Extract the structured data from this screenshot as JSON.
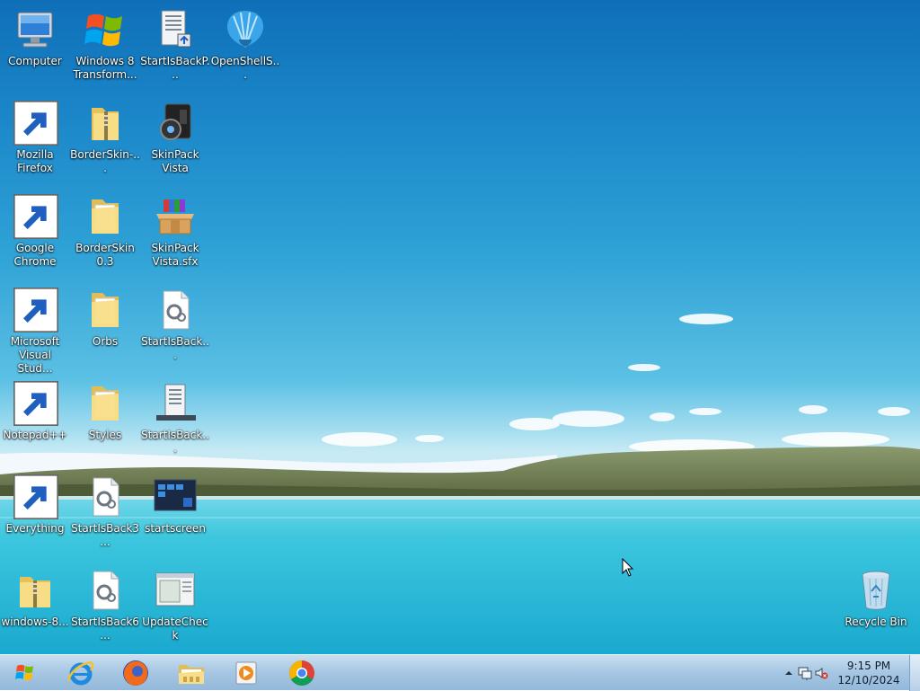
{
  "desktop": {
    "icons": [
      {
        "label": "Computer",
        "icon": "computer-icon"
      },
      {
        "label": "Windows 8 Transform...",
        "icon": "windows-logo-icon"
      },
      {
        "label": "StartIsBackP...",
        "icon": "installer-icon"
      },
      {
        "label": "OpenShellS...",
        "icon": "shell-icon"
      },
      {
        "label": "Mozilla Firefox",
        "icon": "firefox-icon"
      },
      {
        "label": "BorderSkin-...",
        "icon": "zip-folder-icon"
      },
      {
        "label": "SkinPack Vista",
        "icon": "skinpack-icon"
      },
      {
        "label": "Google Chrome",
        "icon": "chrome-icon"
      },
      {
        "label": "BorderSkin 0.3",
        "icon": "folder-icon"
      },
      {
        "label": "SkinPack Vista.sfx",
        "icon": "archive-box-icon"
      },
      {
        "label": "Microsoft Visual Stud...",
        "icon": "visual-studio-icon"
      },
      {
        "label": "Orbs",
        "icon": "folder-icon"
      },
      {
        "label": "StartIsBack...",
        "icon": "settings-file-icon"
      },
      {
        "label": "Notepad++",
        "icon": "notepad-plus-icon"
      },
      {
        "label": "Styles",
        "icon": "folder-icon"
      },
      {
        "label": "StartIsBack...",
        "icon": "installer-icon"
      },
      {
        "label": "Everything",
        "icon": "everything-search-icon"
      },
      {
        "label": "StartIsBack3...",
        "icon": "settings-file-icon"
      },
      {
        "label": "startscreen",
        "icon": "screenshot-file-icon"
      },
      {
        "label": "windows-8...",
        "icon": "zip-folder-icon"
      },
      {
        "label": "StartIsBack6...",
        "icon": "settings-file-icon"
      },
      {
        "label": "UpdateCheck",
        "icon": "window-app-icon"
      },
      {
        "label": "Recycle Bin",
        "icon": "recycle-bin-icon"
      }
    ]
  },
  "taskbar": {
    "start": {
      "icon": "windows-start-icon"
    },
    "pinned": [
      {
        "app": "Internet Explorer",
        "icon": "internet-explorer-icon"
      },
      {
        "app": "Firefox",
        "icon": "firefox-icon"
      },
      {
        "app": "File Explorer",
        "icon": "file-explorer-icon"
      },
      {
        "app": "Media Player",
        "icon": "media-player-icon"
      },
      {
        "app": "Chrome",
        "icon": "chrome-icon"
      }
    ],
    "tray": {
      "icons": [
        "show-hidden-icons-icon",
        "network-icon",
        "volume-muted-icon"
      ],
      "time": "9:15 PM",
      "date": "12/10/2024"
    }
  },
  "colors": {
    "sky_top": "#0f6fb8",
    "lake": "#3dc3dd",
    "taskbar": "#a8c8e4"
  }
}
